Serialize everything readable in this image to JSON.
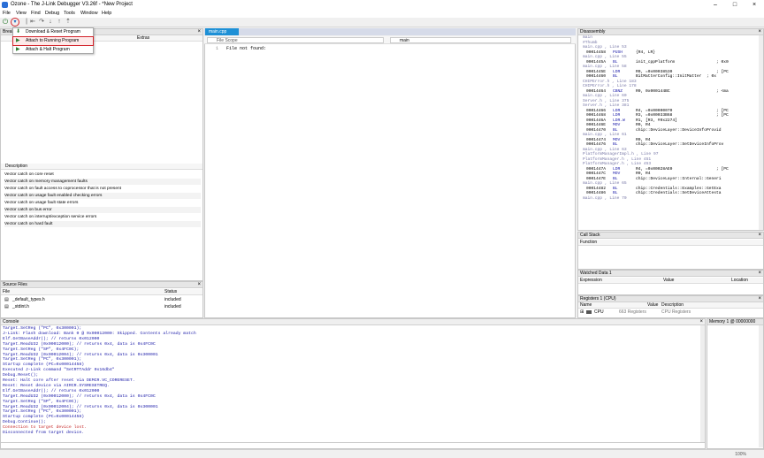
{
  "window": {
    "title": "Ozone - The J-Link Debugger V3.26f - *New Project",
    "minimize": "–",
    "maximize": "□",
    "close": "×"
  },
  "menu": [
    "File",
    "View",
    "Find",
    "Debug",
    "Tools",
    "Window",
    "Help"
  ],
  "toolbar": {
    "power_icon": "power-icon",
    "dropdown_icon": "chevron-down-icon"
  },
  "debug_menu": {
    "items": [
      {
        "label": "Download & Reset Program",
        "icon": "download-icon"
      },
      {
        "label": "Attach to Running Program",
        "icon": "play-icon"
      },
      {
        "label": "Attach & Halt Program",
        "icon": "play-icon"
      }
    ]
  },
  "breakpoints": {
    "title": "Break",
    "col_extras": "Extras",
    "col_description": "Description",
    "vectors": [
      "Vector catch on core reset",
      "Vector catch on memory management faults",
      "Vector catch on fault access to coprocessor that is not present",
      "Vector catch on usage fault enabled checking errors",
      "Vector catch on usage fault state errors",
      "Vector catch on bus error",
      "Vector catch on interrupt/exception service errors",
      "Vector catch on hard fault"
    ]
  },
  "source_files": {
    "title": "Source Files",
    "col_file": "File",
    "col_status": "Status",
    "rows": [
      {
        "file": "_default_types.h",
        "status": "included"
      },
      {
        "file": "_stdint.h",
        "status": "included"
      }
    ]
  },
  "editor": {
    "tab": "main.cpp",
    "scope_placeholder": "File Scope",
    "function": "main",
    "line_number": "1",
    "content": "File not found:"
  },
  "disassembly": {
    "title": "Disassembly",
    "lines": [
      {
        "t": "src",
        "text": "main"
      },
      {
        "t": "src",
        "text": "#Thumb"
      },
      {
        "t": "src",
        "text": "main.cpp , Line 53"
      },
      {
        "t": "ins",
        "addr": "00014458",
        "op": "PUSH",
        "args": "{R4, LR}"
      },
      {
        "t": "src",
        "text": "main.cpp , Line 55"
      },
      {
        "t": "ins",
        "addr": "0001445A",
        "op": "BL",
        "args": "init_cppPlatform                 ; 0x0"
      },
      {
        "t": "src",
        "text": "main.cpp , Line 58"
      },
      {
        "t": "ins",
        "addr": "0001445E",
        "op": "LDR",
        "args": "R0, =0x00038530                  ; [PC"
      },
      {
        "t": "ins",
        "addr": "00014460",
        "op": "BL",
        "args": "BitMatterConfig::InitMatter  ; 0x"
      },
      {
        "t": "src",
        "text": "CHIPError.h , Line 183"
      },
      {
        "t": "src",
        "text": "CHIPError.h , Line 178"
      },
      {
        "t": "ins",
        "addr": "00014464",
        "op": "CBNZ",
        "args": "R0, 0x000144BC                   ; <ma"
      },
      {
        "t": "src",
        "text": "main.cpp , Line 60"
      },
      {
        "t": "src",
        "text": "Server.h , Line 375"
      },
      {
        "t": "src",
        "text": "Server.h , Line 381"
      },
      {
        "t": "ins",
        "addr": "00014466",
        "op": "LDR",
        "args": "R4, =0x00000070                  ; [PC"
      },
      {
        "t": "ins",
        "addr": "00014468",
        "op": "LDR",
        "args": "R3, =0x00033B68                  ; [PC"
      },
      {
        "t": "ins",
        "addr": "0001446A",
        "op": "LDR.W",
        "args": "R1, [R3, #0x2274]"
      },
      {
        "t": "ins",
        "addr": "0001446E",
        "op": "MOV",
        "args": "R0, R4"
      },
      {
        "t": "ins",
        "addr": "00014470",
        "op": "BL",
        "args": "chip::DeviceLayer::DeviceInfoProvid"
      },
      {
        "t": "src",
        "text": "main.cpp , Line 61"
      },
      {
        "t": "ins",
        "addr": "00014474",
        "op": "MOV",
        "args": "R0, R4"
      },
      {
        "t": "ins",
        "addr": "00014476",
        "op": "BL",
        "args": "chip::DeviceLayer::SetDeviceInfoProv"
      },
      {
        "t": "src",
        "text": "main.cpp , Line 63"
      },
      {
        "t": "src",
        "text": "PlatformManagerImpl.h , Line 97"
      },
      {
        "t": "src",
        "text": "PlatformManager.h , Line 451"
      },
      {
        "t": "src",
        "text": "PlatformManager.h , Line 453"
      },
      {
        "t": "ins",
        "addr": "0001447A",
        "op": "LDR",
        "args": "R4, =0x00028AE0                  ; [PC"
      },
      {
        "t": "ins",
        "addr": "0001447C",
        "op": "MOV",
        "args": "R0, R4"
      },
      {
        "t": "ins",
        "addr": "0001447E",
        "op": "BL",
        "args": "chip::DeviceLayer::Internal::Generi"
      },
      {
        "t": "src",
        "text": "main.cpp , Line 65"
      },
      {
        "t": "ins",
        "addr": "00014482",
        "op": "BL",
        "args": "chip::Credentials::Examples::GetExa"
      },
      {
        "t": "ins",
        "addr": "00014486",
        "op": "BL",
        "args": "chip::Credentials::SetDeviceAttesta"
      },
      {
        "t": "src",
        "text": "main.cpp , Line 70"
      }
    ]
  },
  "call_stack": {
    "title": "Call Stack",
    "col_function": "Function"
  },
  "watched_data": {
    "title": "Watched Data 1",
    "col_expression": "Expression",
    "col_value": "Value",
    "col_location": "Location"
  },
  "registers": {
    "title": "Registers 1 (CPU)",
    "col_name": "Name",
    "col_value": "Value",
    "col_description": "Description",
    "row_name": "CPU",
    "row_value": "663 Registers",
    "row_description": "CPU Registers"
  },
  "console": {
    "title": "Console",
    "lines": [
      {
        "c": "blue",
        "text": "Target.SetReg (\"PC\", 0x300001);"
      },
      {
        "c": "blue",
        "text": "J-Link: Flash download: Bank 0 @ 0x00012000: Skipped. Contents already match"
      },
      {
        "c": "blue",
        "text": "Elf.GetBaseAddr(); // returns 0x012000"
      },
      {
        "c": "blue",
        "text": "Target.ReadU32 (0x00012000); // returns 0x4, data is 0x4FC0C"
      },
      {
        "c": "blue",
        "text": "Target.SetReg (\"SP\", 0x4FC0C);"
      },
      {
        "c": "blue",
        "text": "Target.ReadU32 (0x00012004); // returns 0x4, data is 0x300001"
      },
      {
        "c": "blue",
        "text": "Target.SetReg (\"PC\", 0x300001);"
      },
      {
        "c": "blue",
        "text": "Startup complete (PC=0x00014458)"
      },
      {
        "c": "blue",
        "text": "Executed J-Link command \"SetRTTAddr 0x16db4\""
      },
      {
        "c": "blue",
        "text": "Debug.Reset();"
      },
      {
        "c": "blue",
        "text": "Reset: Halt core after reset via DEMCR.VC_CORERESET."
      },
      {
        "c": "blue",
        "text": "Reset: Reset device via AIRCR.SYSRESETREQ."
      },
      {
        "c": "blue",
        "text": "Elf.GetBaseAddr(); // returns 0x012000"
      },
      {
        "c": "blue",
        "text": "Target.ReadU32 (0x00012000); // returns 0x4, data is 0x4FC0C"
      },
      {
        "c": "blue",
        "text": "Target.SetReg (\"SP\", 0x4FC0C);"
      },
      {
        "c": "blue",
        "text": "Target.ReadU32 (0x00012004); // returns 0x4, data is 0x300001"
      },
      {
        "c": "blue",
        "text": "Target.SetReg (\"PC\", 0x300001);"
      },
      {
        "c": "blue",
        "text": "Startup complete (PC=0x00014458)"
      },
      {
        "c": "blue",
        "text": "Debug.Continue();"
      },
      {
        "c": "red",
        "text": "Connection to target device lost."
      },
      {
        "c": "blue",
        "text": "Disconnected from target device."
      }
    ]
  },
  "memory": {
    "title": "Memory 1 @ 00000000"
  },
  "status_bar": {
    "zoom": "100%"
  }
}
